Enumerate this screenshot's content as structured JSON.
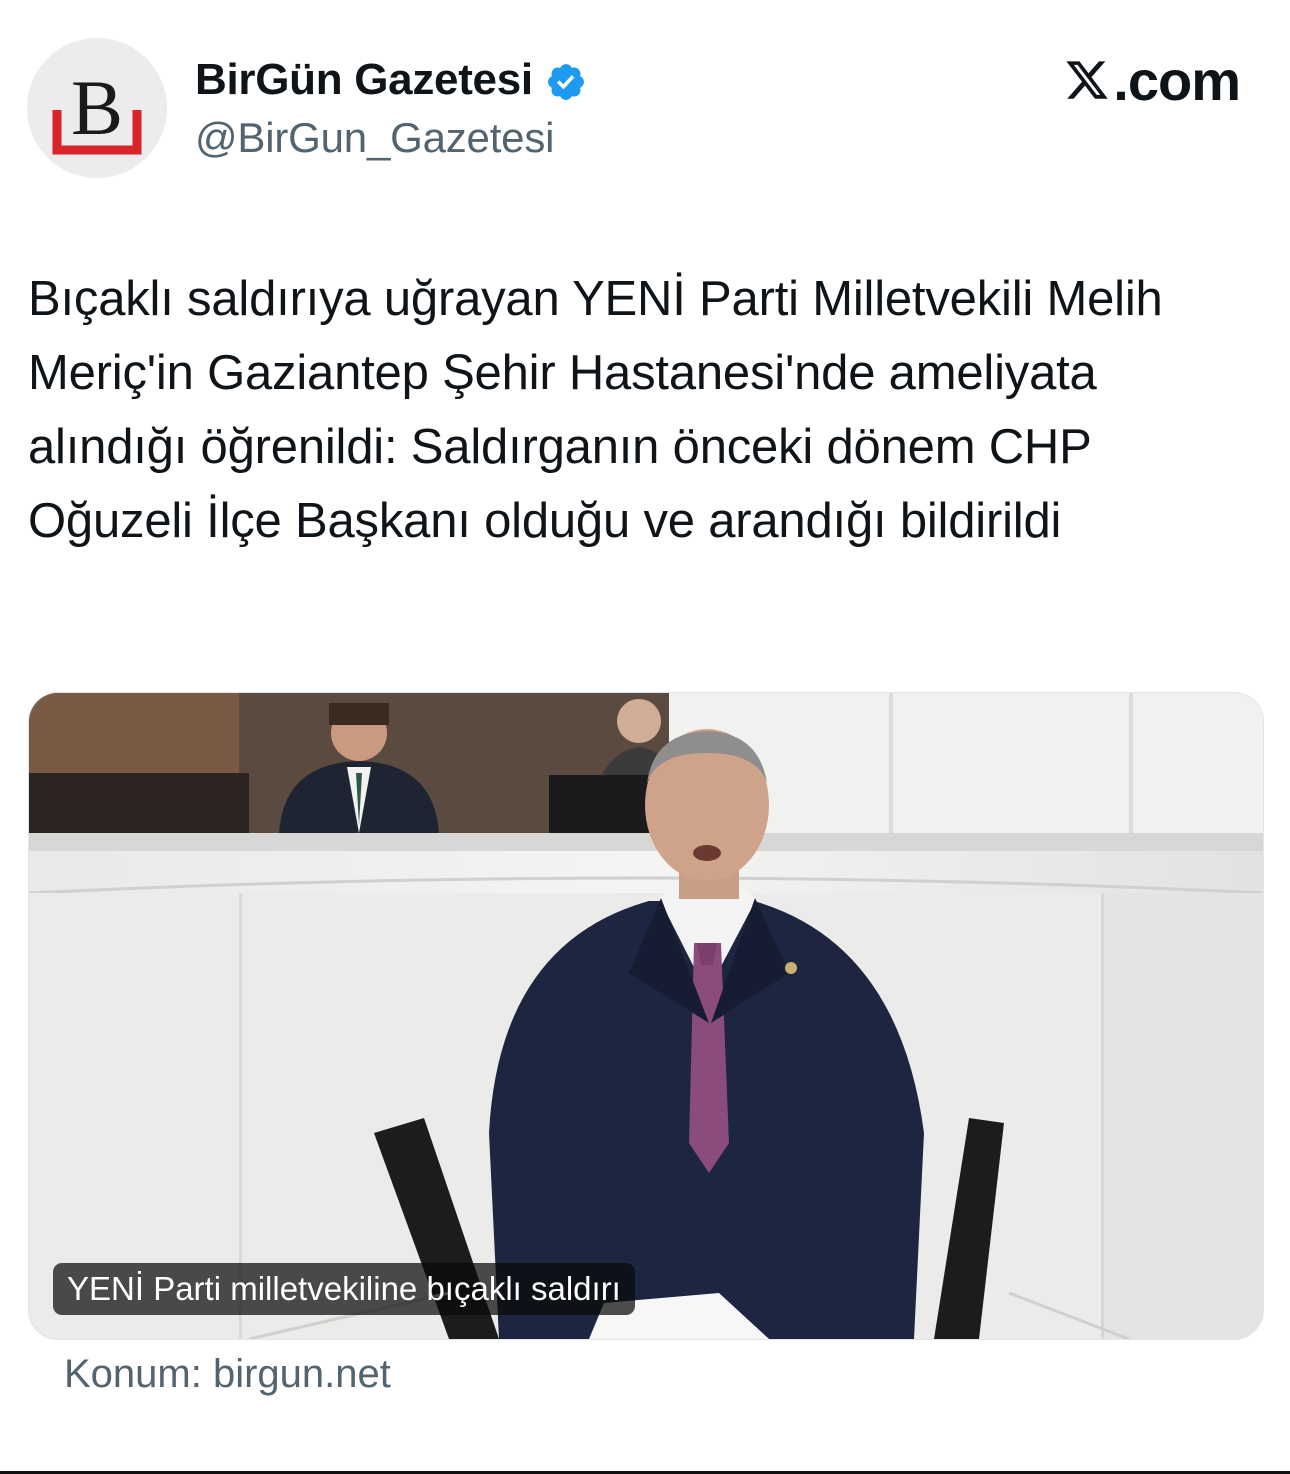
{
  "account": {
    "name": "BirGün Gazetesi",
    "handle": "@BirGun_Gazetesi",
    "avatar_letter": "B",
    "avatar_accent_color": "#d9242b",
    "verified_icon": "verified-badge-icon",
    "verified_color": "#1d9bf0"
  },
  "brand": {
    "logo_icon": "x-logo-icon",
    "suffix": ".com"
  },
  "tweet": {
    "text": "Bıçaklı saldırıya uğrayan YENİ Parti Milletvekili Melih Meriç'in Gaziantep Şehir Hastanesi'nde ameliyata alındığı öğrenildi: Saldırganın önceki dönem CHP Oğuzeli İlçe Başkanı olduğu ve arandığı bildirildi"
  },
  "media": {
    "caption": "YENİ Parti milletvekiline bıçaklı saldırı"
  },
  "link": {
    "source": "Konum: birgun.net"
  }
}
